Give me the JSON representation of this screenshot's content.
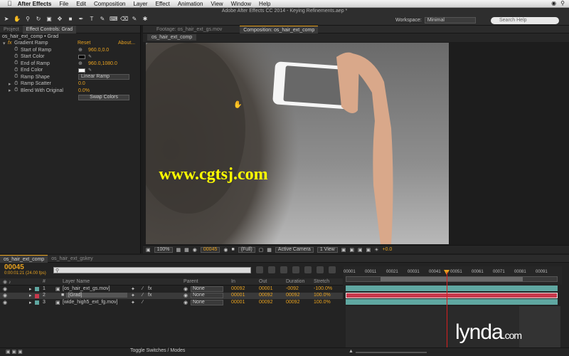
{
  "menubar": {
    "app": "After Effects",
    "items": [
      "File",
      "Edit",
      "Composition",
      "Layer",
      "Effect",
      "Animation",
      "View",
      "Window",
      "Help"
    ]
  },
  "document_title": "Adobe After Effects CC 2014 - Keying Refinements.aep *",
  "workspace": {
    "label": "Workspace:",
    "value": "Minimal"
  },
  "search_help": {
    "placeholder": "Search Help"
  },
  "left_panel": {
    "tabs": [
      "Project",
      "Effect Controls: Grad"
    ],
    "header": "os_hair_ext_comp • Grad",
    "effect": {
      "name": "Gradient Ramp",
      "reset": "Reset",
      "about": "About..."
    },
    "props": {
      "start_of_ramp": {
        "label": "Start of Ramp",
        "value": "960.0,0.0"
      },
      "start_color": {
        "label": "Start Color",
        "color": "#000000"
      },
      "end_of_ramp": {
        "label": "End of Ramp",
        "value": "960.0,1080.0"
      },
      "end_color": {
        "label": "End Color",
        "color": "#ffffff"
      },
      "ramp_shape": {
        "label": "Ramp Shape",
        "value": "Linear Ramp"
      },
      "ramp_scatter": {
        "label": "Ramp Scatter",
        "value": "0.0"
      },
      "blend": {
        "label": "Blend With Original",
        "value": "0.0%"
      }
    },
    "swap_colors": "Swap Colors"
  },
  "comp_panel": {
    "tabs": [
      "Footage: os_hair_ext_gs.mov",
      "Composition: os_hair_ext_comp"
    ],
    "subtab": "os_hair_ext_comp"
  },
  "viewer_footer": {
    "zoom": "100%",
    "timecode": "00045",
    "resolution": "(Full)",
    "camera": "Active Camera",
    "view": "1 View",
    "exposure": "+0.0"
  },
  "watermark": "www.cgtsj.com",
  "timeline": {
    "tabs": [
      "os_hair_ext_comp",
      "os_hair_ext_gskey"
    ],
    "timecode": "00045",
    "timecode_sub": "0:00:01:21 (24.00 fps)",
    "columns": {
      "num": "#",
      "layer_name": "Layer Name",
      "parent": "Parent",
      "in": "In",
      "out": "Out",
      "duration": "Duration",
      "stretch": "Stretch"
    },
    "layers": [
      {
        "num": "1",
        "name": "[os_hair_ext_gs.mov]",
        "parent": "None",
        "in": "00092",
        "out": "00001",
        "duration": "-0092",
        "stretch": "-100.0%",
        "color": "#5fa7a1"
      },
      {
        "num": "2",
        "name": "[Grad]",
        "parent": "None",
        "in": "00001",
        "out": "00092",
        "duration": "00092",
        "stretch": "100.0%",
        "color": "#c8394c"
      },
      {
        "num": "3",
        "name": "[wide_high5_ext_fg.mov]",
        "parent": "None",
        "in": "00001",
        "out": "00092",
        "duration": "00092",
        "stretch": "100.0%",
        "color": "#5fa7a1"
      }
    ],
    "ruler_ticks": [
      "00001",
      "00011",
      "00021",
      "00031",
      "00041",
      "00051",
      "00061",
      "00071",
      "00081",
      "00091"
    ],
    "toggle_label": "Toggle Switches / Modes"
  },
  "lynda_logo": "lynda.com"
}
